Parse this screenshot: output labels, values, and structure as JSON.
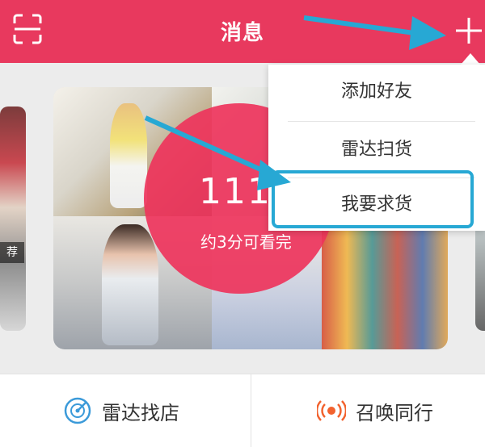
{
  "header": {
    "title": "消息",
    "scan_icon": "scan-frame-icon",
    "add_icon": "plus-icon",
    "background": "#e8395e"
  },
  "carousel": {
    "side_left_tag": "荐",
    "count_text": "111",
    "subtitle": "约3分可看完",
    "circle_color": "#ee345c"
  },
  "dropdown_menu": {
    "items": [
      {
        "label": "添加好友"
      },
      {
        "label": "雷达扫货"
      },
      {
        "label": "我要求货"
      }
    ],
    "highlighted_index": 2,
    "highlight_color": "#27a8d4"
  },
  "footer": {
    "left": {
      "label": "雷达找店",
      "icon": "radar-icon"
    },
    "right": {
      "label": "召唤同行",
      "icon": "broadcast-icon"
    }
  }
}
